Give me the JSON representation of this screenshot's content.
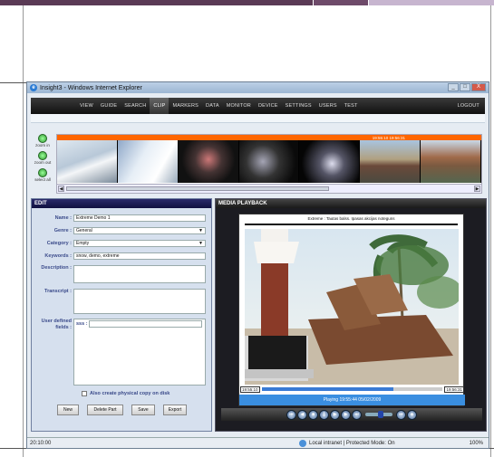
{
  "browser": {
    "title": "Insight3 - Windows Internet Explorer",
    "window_buttons": [
      "_",
      "□",
      "X"
    ]
  },
  "nav": {
    "items": [
      "VIEW",
      "GUIDE",
      "SEARCH",
      "CLIP",
      "MARKERS",
      "DATA",
      "MONITOR",
      "DEVICE",
      "SETTINGS",
      "USERS",
      "TEST"
    ],
    "active": "CLIP",
    "logout": "LOGOUT"
  },
  "zoom": {
    "zoom_in": "zoom in",
    "zoom_out": "zoom out",
    "select_all": "select all"
  },
  "timeline": {
    "header_time": "19:55:10 19:56:31"
  },
  "edit": {
    "title": "EDIT",
    "fields": {
      "name_label": "Name :",
      "name_value": "Extreme Demo 1",
      "genre_label": "Genre :",
      "genre_value": "General",
      "category_label": "Category :",
      "category_value": "Empty",
      "keywords_label": "Keywords :",
      "keywords_value": "snow, demo, extreme",
      "description_label": "Description :",
      "transcript_label": "Transcript :",
      "user_defined_label": "User defined fields :",
      "udf_name": "sss :"
    },
    "checkbox_label": "Also create physical copy on disk",
    "buttons": {
      "new": "New",
      "delete_part": "Delete Part",
      "save": "Save",
      "export": "Export"
    }
  },
  "media": {
    "title": "MEDIA PLAYBACK",
    "clip_title": "Extreme : Tautas balss. Ipasas akcijas noteguns",
    "time_start": "19:55:10",
    "time_end": "19:56:31",
    "progress": 0.73,
    "playing_text": "Playing 19:55:44 05/02/2009"
  },
  "status": {
    "time": "20:10:00",
    "zone": "Local intranet | Protected Mode: On",
    "zoom": "100%"
  }
}
